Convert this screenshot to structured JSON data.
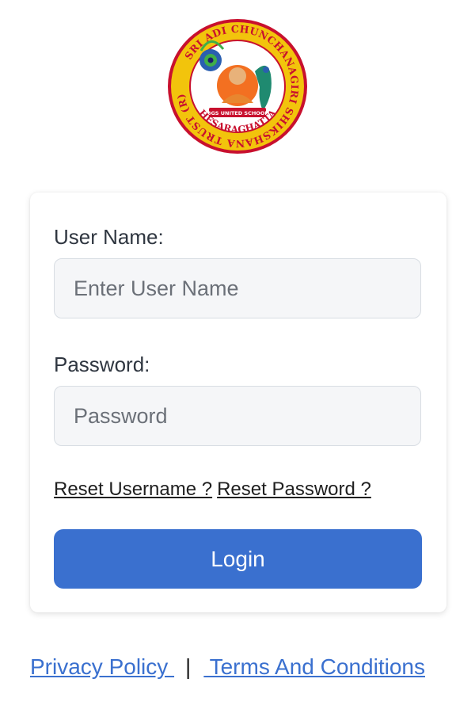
{
  "logo": {
    "ring_text": "SRI ADI CHUNCHANAGIRI SHIKSHANA TRUST (R)",
    "bottom_text": "HESARAGHATTA",
    "banner_text": "BGS UNITED SCHOOL",
    "colors": {
      "ring": "#f2c40c",
      "outer": "#c8102e",
      "inner": "#ffffff"
    }
  },
  "form": {
    "username_label": "User Name:",
    "username_placeholder": "Enter User Name",
    "username_value": "",
    "password_label": "Password:",
    "password_placeholder": "Password",
    "password_value": "",
    "reset_username": "Reset Username ?",
    "reset_password": "Reset Password ?",
    "login_label": "Login"
  },
  "footer": {
    "privacy": "Privacy Policy ",
    "separator": "|",
    "terms": " Terms And Conditions"
  },
  "colors": {
    "accent": "#3a70cf"
  }
}
